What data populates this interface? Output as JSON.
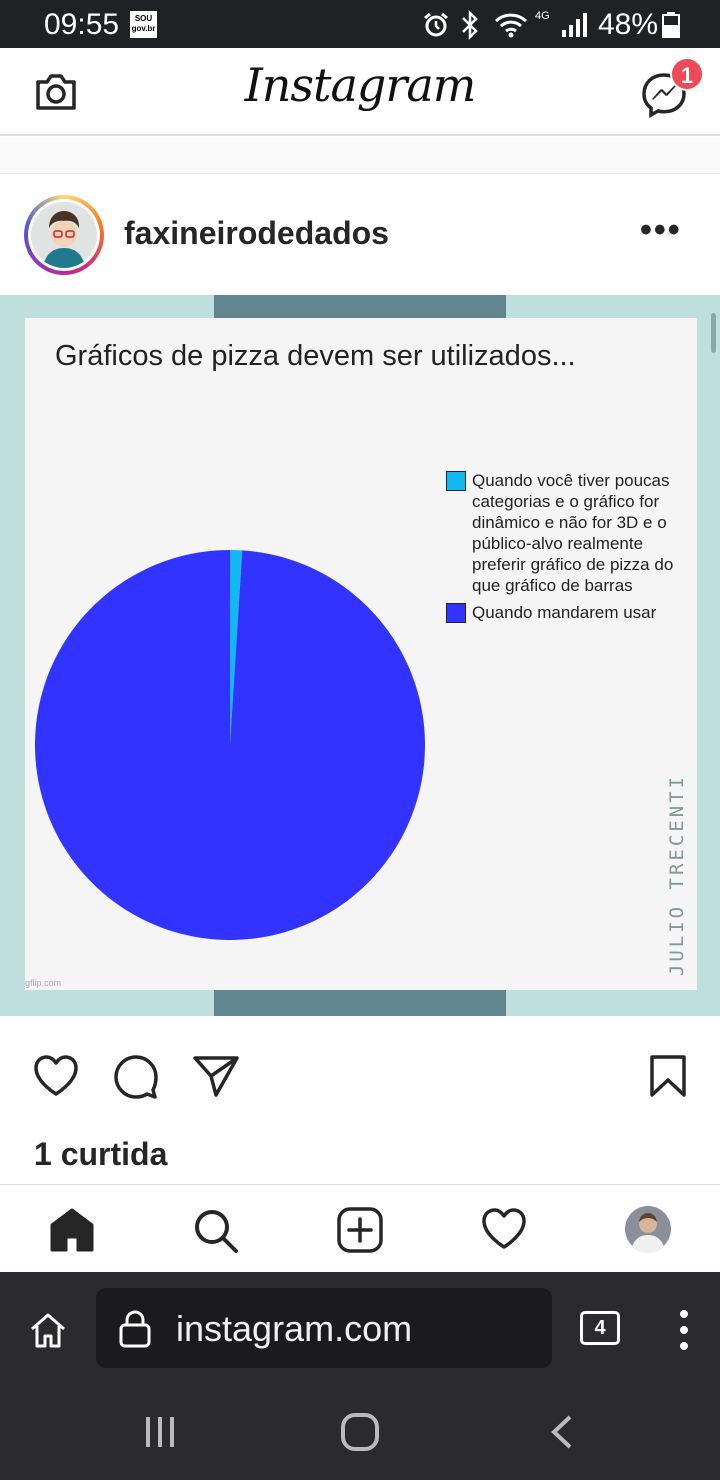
{
  "status_bar": {
    "time": "09:55",
    "notification_app": "sou gov.br",
    "network": "4G",
    "battery": "48%"
  },
  "header": {
    "logo": "Instagram",
    "messenger_badge": "1"
  },
  "post": {
    "username": "faxineirodedados",
    "more_label": "•••",
    "likes": "1 curtida"
  },
  "chart_data": {
    "type": "pie",
    "title": "Gráficos de pizza devem ser utilizados...",
    "slices": [
      {
        "label": "Quando você tiver poucas categorias e o gráfico for dinâmico e não for 3D e o público-alvo realmente preferir gráfico de pizza do que gráfico de barras",
        "value": 1,
        "color": "#12b8f0"
      },
      {
        "label": "Quando mandarem usar",
        "value": 99,
        "color": "#3333ff"
      }
    ],
    "legend_position": "right",
    "signature": "JULIO TRECENTI",
    "watermark": "gflip.com"
  },
  "browser": {
    "url": "instagram.com",
    "tab_count": "4"
  },
  "colors": {
    "accent_badge": "#ed4956",
    "browser_bg": "#2a2a2f"
  }
}
